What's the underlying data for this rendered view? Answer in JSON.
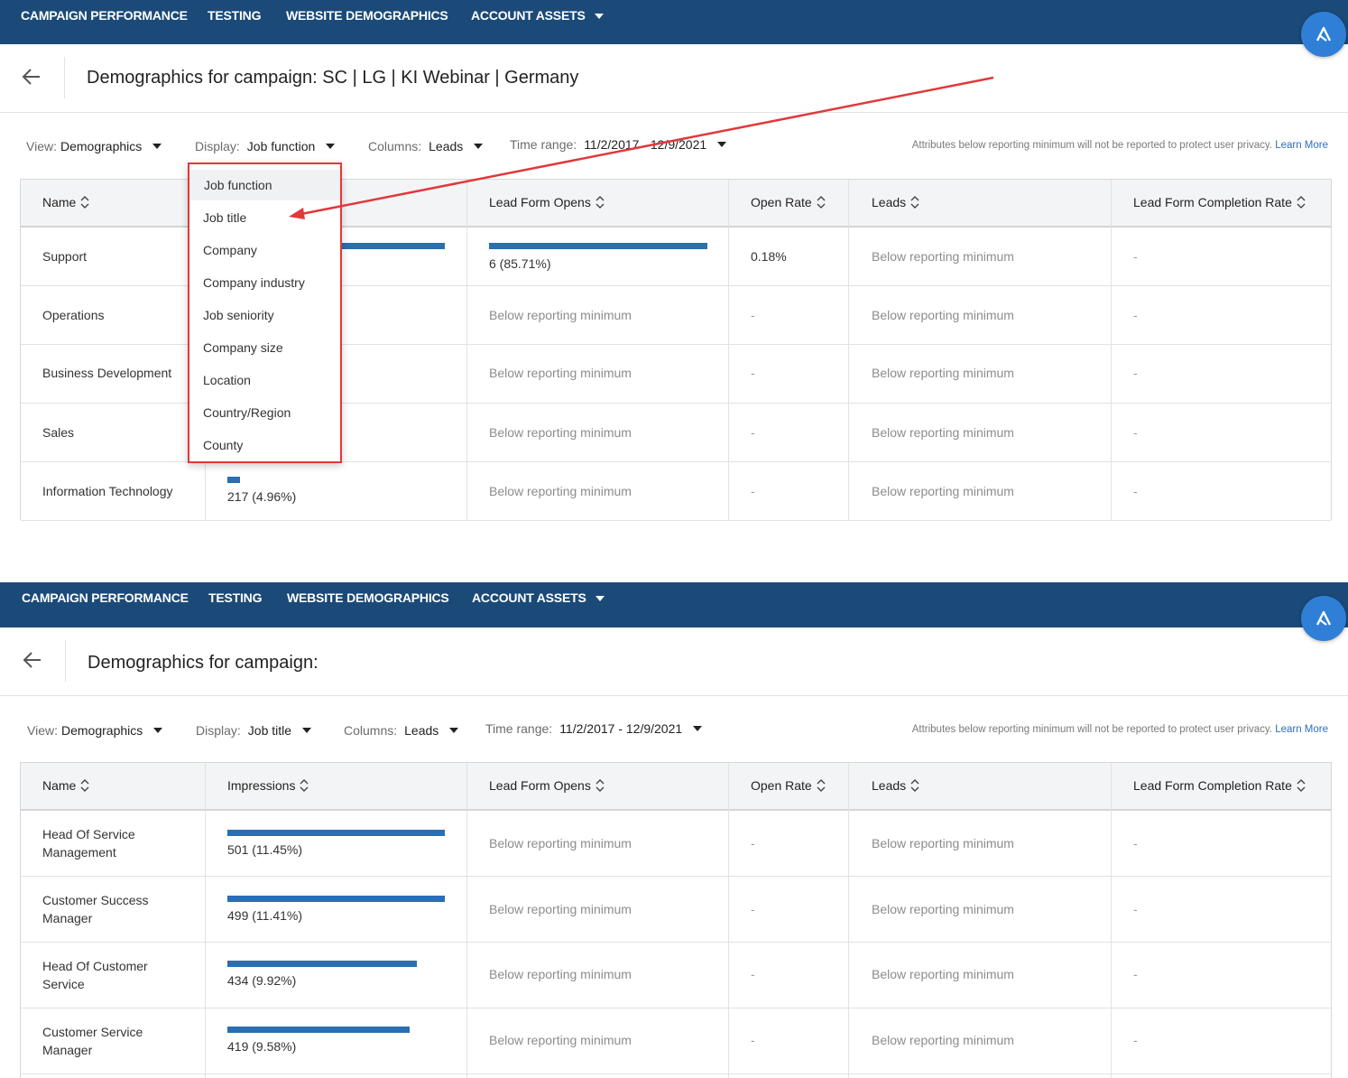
{
  "nav": {
    "items": [
      "CAMPAIGN PERFORMANCE",
      "TESTING",
      "WEBSITE DEMOGRAPHICS",
      "ACCOUNT ASSETS"
    ]
  },
  "privacy": {
    "text": "Attributes below reporting minimum will not be reported to protect user privacy.",
    "link": "Learn More"
  },
  "filters": {
    "view_label": "View:",
    "display_label": "Display:",
    "columns_label": "Columns:",
    "time_label": "Time range:"
  },
  "columns": [
    "Name",
    "Impressions",
    "Lead Form Opens",
    "Open Rate",
    "Leads",
    "Lead Form Completion Rate"
  ],
  "top": {
    "title": "Demographics for campaign: SC | LG | KI Webinar | Germany",
    "view_value": "Demographics",
    "display_value": "Job function",
    "columns_value": "Leads",
    "time_value": "11/2/2017 - 12/9/2021",
    "dropdown_items": [
      "Job function",
      "Job title",
      "Company",
      "Company industry",
      "Job seniority",
      "Company size",
      "Location",
      "Country/Region",
      "County"
    ],
    "rows": [
      {
        "name": "Support",
        "impressions_share": 1.0,
        "impressions": "",
        "opens_bar": 1.0,
        "opens": "6 (85.71%)",
        "open_rate": "0.18%",
        "leads": "Below reporting minimum",
        "completion": "-"
      },
      {
        "name": "Operations",
        "impressions": "",
        "opens": "Below reporting minimum",
        "open_rate": "-",
        "leads": "Below reporting minimum",
        "completion": "-"
      },
      {
        "name": "Business Development",
        "impressions": "",
        "opens": "Below reporting minimum",
        "open_rate": "-",
        "leads": "Below reporting minimum",
        "completion": "-"
      },
      {
        "name": "Sales",
        "impressions": "",
        "opens": "Below reporting minimum",
        "open_rate": "-",
        "leads": "Below reporting minimum",
        "completion": "-"
      },
      {
        "name": "Information Technology",
        "impressions_share": 0.06,
        "impressions": "217 (4.96%)",
        "opens": "Below reporting minimum",
        "open_rate": "-",
        "leads": "Below reporting minimum",
        "completion": "-"
      }
    ]
  },
  "bottom": {
    "title": "Demographics for campaign:",
    "view_value": "Demographics",
    "display_value": "Job title",
    "columns_value": "Leads",
    "time_value": "11/2/2017 - 12/9/2021",
    "rows": [
      {
        "name_line1": "Head Of Service",
        "name_line2": "Management",
        "impressions_share": 1.0,
        "impressions": "501 (11.45%)",
        "opens": "Below reporting minimum",
        "open_rate": "-",
        "leads": "Below reporting minimum",
        "completion": "-"
      },
      {
        "name_line1": "Customer Success",
        "name_line2": "Manager",
        "impressions_share": 1.0,
        "impressions": "499 (11.41%)",
        "opens": "Below reporting minimum",
        "open_rate": "-",
        "leads": "Below reporting minimum",
        "completion": "-"
      },
      {
        "name_line1": "Head Of Customer",
        "name_line2": "Service",
        "impressions_share": 0.87,
        "impressions": "434 (9.92%)",
        "opens": "Below reporting minimum",
        "open_rate": "-",
        "leads": "Below reporting minimum",
        "completion": "-"
      },
      {
        "name_line1": "Customer Service",
        "name_line2": "Manager",
        "impressions_share": 0.84,
        "impressions": "419 (9.58%)",
        "opens": "Below reporting minimum",
        "open_rate": "-",
        "leads": "Below reporting minimum",
        "completion": "-"
      }
    ]
  },
  "colors": {
    "nav_bg": "#1b4a78",
    "accent": "#2a6fb1",
    "annotation": "#e0393b"
  }
}
